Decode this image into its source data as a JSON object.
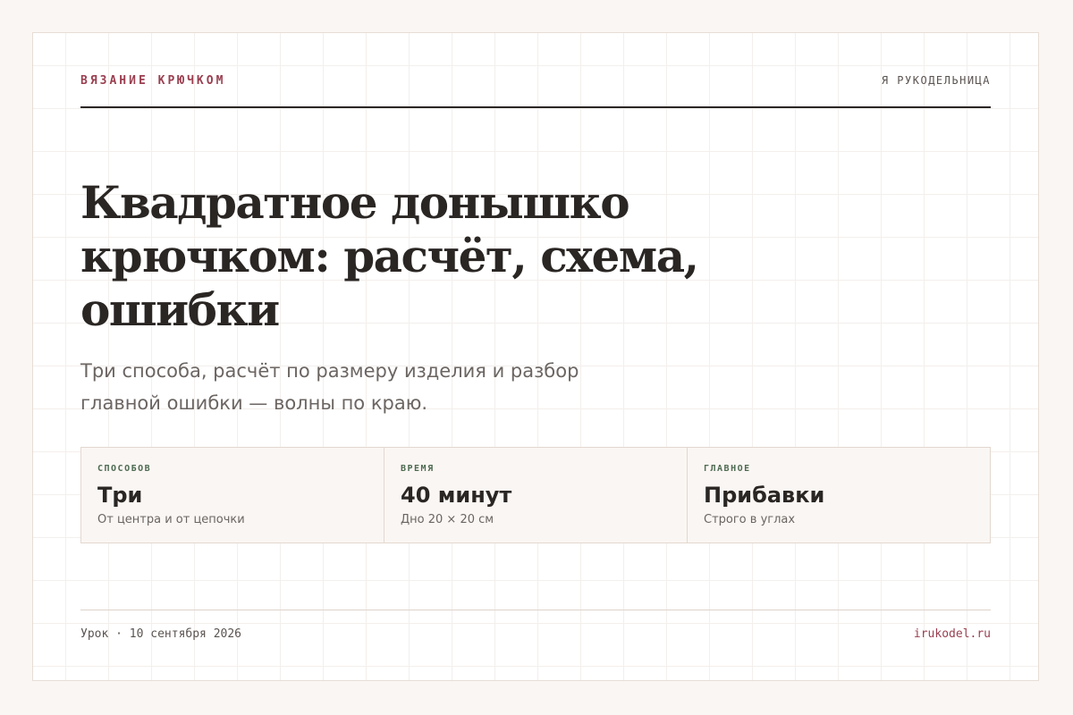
{
  "header": {
    "kicker": "ВЯЗАНИЕ КРЮЧКОМ",
    "brand": "Я РУКОДЕЛЬНИЦА"
  },
  "article": {
    "title": "Квадратное донышко крючком: расчёт, схема, ошибки",
    "subtitle": "Три способа, расчёт по размеру изделия и разбор главной ошибки — волны по краю."
  },
  "stats": [
    {
      "label": "СПОСОБОВ",
      "value": "Три",
      "note": "От центра и от цепочки"
    },
    {
      "label": "ВРЕМЯ",
      "value": "40 минут",
      "note": "Дно 20 × 20 см"
    },
    {
      "label": "ГЛАВНОЕ",
      "value": "Прибавки",
      "note": "Строго в углах"
    }
  ],
  "footer": {
    "meta": "Урок · 10 сентября 2026",
    "site": "irukodel.ru"
  },
  "colors": {
    "background": "#faf6f3",
    "accent": "#9a3f50",
    "label_green": "#4e6b52",
    "text": "#2a2624",
    "muted": "#6b6562"
  }
}
